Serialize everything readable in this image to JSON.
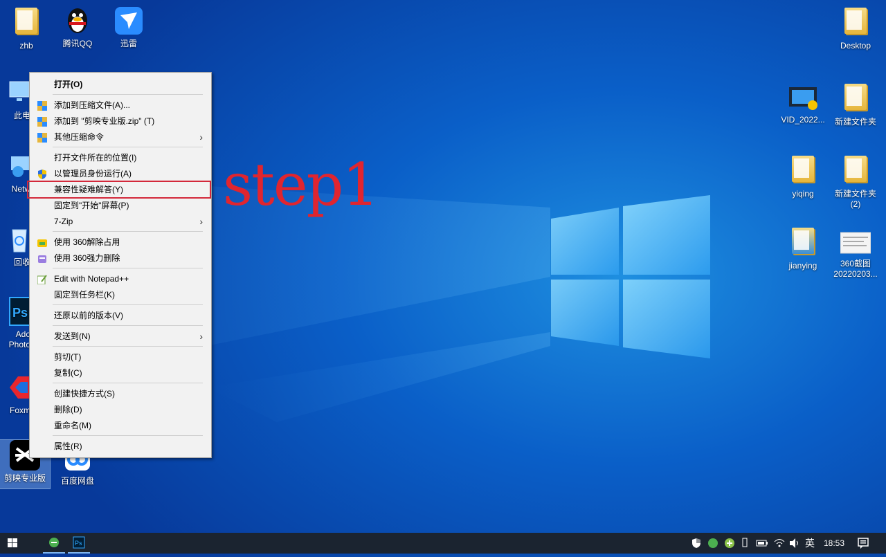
{
  "desktop": {
    "left_icons": [
      {
        "name": "zhb",
        "label": "zhb"
      },
      {
        "name": "qq",
        "label": "腾讯QQ"
      },
      {
        "name": "xunlei",
        "label": "迅雷"
      },
      {
        "name": "this-pc",
        "label": "此电"
      },
      {
        "name": "network",
        "label": "Netw"
      },
      {
        "name": "recycle",
        "label": "回收"
      },
      {
        "name": "photoshop",
        "label": "Ado\nPhoto"
      },
      {
        "name": "foxmail",
        "label": "Foxm"
      },
      {
        "name": "jianying",
        "label": "剪映专业版"
      },
      {
        "name": "baidu",
        "label": "百度网盘"
      }
    ],
    "right_icons": [
      {
        "name": "desktop-folder",
        "label": "Desktop"
      },
      {
        "name": "vid",
        "label": "VID_2022..."
      },
      {
        "name": "new-folder",
        "label": "新建文件夹"
      },
      {
        "name": "yiqing",
        "label": "yiqing"
      },
      {
        "name": "new-folder-2",
        "label": "新建文件夹\n(2)"
      },
      {
        "name": "jianying-folder",
        "label": "jianying"
      },
      {
        "name": "360shot",
        "label": "360截图\n20220203..."
      }
    ]
  },
  "context_menu": {
    "items": [
      {
        "label": "打开(O)"
      },
      {
        "label": "添加到压缩文件(A)..."
      },
      {
        "label": "添加到 \"剪映专业版.zip\" (T)"
      },
      {
        "label": "其他压缩命令"
      },
      {
        "label": "打开文件所在的位置(I)"
      },
      {
        "label": "以管理员身份运行(A)"
      },
      {
        "label": "兼容性疑难解答(Y)"
      },
      {
        "label": "固定到\"开始\"屏幕(P)"
      },
      {
        "label": "7-Zip"
      },
      {
        "label": "使用 360解除占用"
      },
      {
        "label": "使用 360强力删除"
      },
      {
        "label": "Edit with Notepad++"
      },
      {
        "label": "固定到任务栏(K)"
      },
      {
        "label": "还原以前的版本(V)"
      },
      {
        "label": "发送到(N)"
      },
      {
        "label": "剪切(T)"
      },
      {
        "label": "复制(C)"
      },
      {
        "label": "创建快捷方式(S)"
      },
      {
        "label": "删除(D)"
      },
      {
        "label": "重命名(M)"
      },
      {
        "label": "属性(R)"
      }
    ],
    "arrow": "›"
  },
  "annotation": {
    "text": "step1",
    "color": "#e0252f"
  },
  "taskbar": {
    "time": "18:53",
    "ime": "英"
  }
}
